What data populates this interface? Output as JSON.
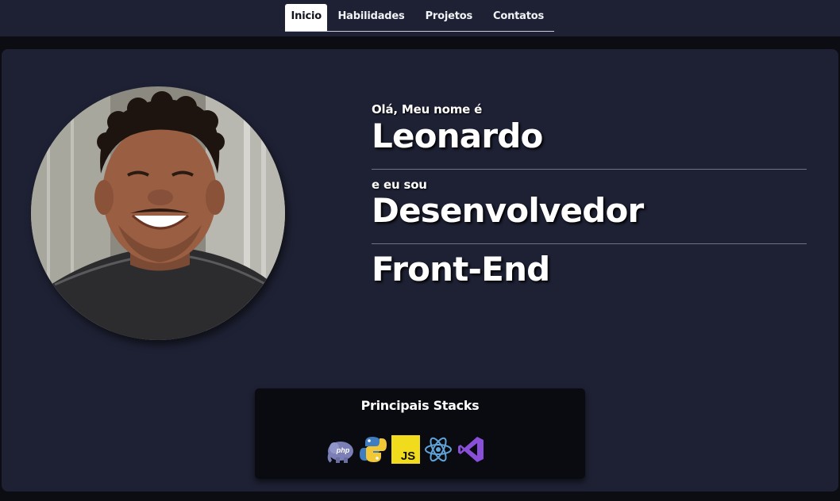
{
  "nav": {
    "tabs": [
      {
        "label": "Inicio",
        "active": true
      },
      {
        "label": "Habilidades",
        "active": false
      },
      {
        "label": "Projetos",
        "active": false
      },
      {
        "label": "Contatos",
        "active": false
      }
    ]
  },
  "hero": {
    "greeting": "Olá, Meu nome é",
    "name": "Leonardo",
    "role_prefix": "e eu sou",
    "role_line1": "Desenvolvedor",
    "role_line2": "Front-End"
  },
  "stacks": {
    "title": "Principais Stacks",
    "icons": [
      "php-elephant-icon",
      "python-icon",
      "javascript-icon",
      "react-icon",
      "visual-studio-icon"
    ],
    "js_badge_text": "JS"
  },
  "colors": {
    "page_bg": "#0c0d12",
    "panel_bg": "#1e2134",
    "stack_box_bg": "#0a0b10",
    "js_yellow": "#f0db1c",
    "react_blue": "#61a3d8",
    "vs_purple": "#8a4fd8"
  }
}
